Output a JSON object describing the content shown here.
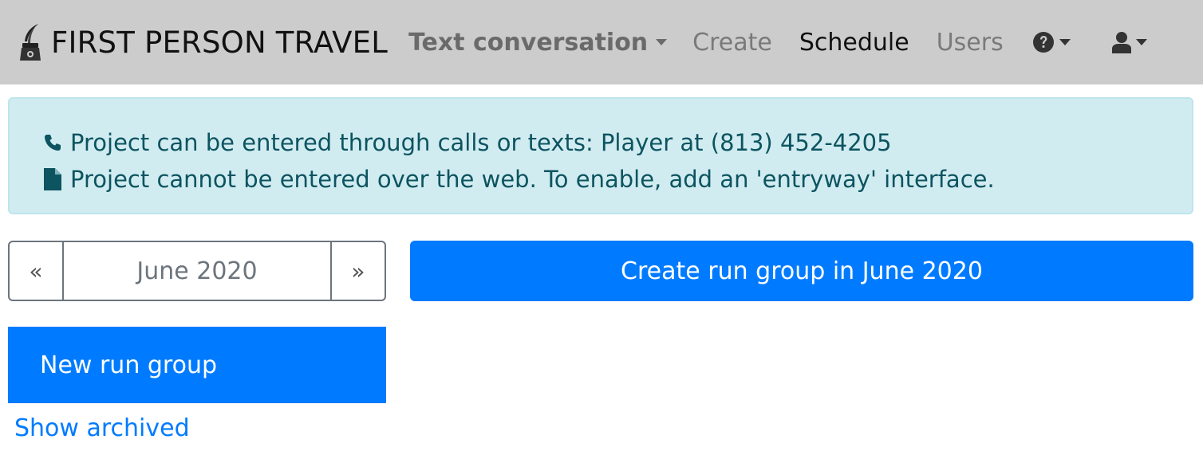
{
  "navbar": {
    "brand": "FIRST PERSON TRAVEL",
    "project_menu": "Text conversation",
    "links": {
      "create": "Create",
      "schedule": "Schedule",
      "users": "Users"
    },
    "icons": [
      "quill-logo-icon",
      "question-circle-icon",
      "user-icon",
      "chevron-down-icon"
    ],
    "colors": {
      "background": "#cccccc",
      "active_link": "#111111"
    }
  },
  "alert": {
    "line1": "Project can be entered through calls or texts: Player at (813) 452-4205",
    "line2": "Project cannot be entered over the web. To enable, add an 'entryway' interface.",
    "icons": [
      "phone-icon",
      "file-icon"
    ],
    "colors": {
      "background": "#d1ecf1",
      "text": "#0c5460"
    }
  },
  "month_nav": {
    "prev": "«",
    "label": "June 2020",
    "next": "»"
  },
  "create_button": "Create run group in June 2020",
  "run_groups": [
    {
      "label": "New run group"
    }
  ],
  "show_archived": "Show archived",
  "colors": {
    "primary": "#007bff"
  }
}
